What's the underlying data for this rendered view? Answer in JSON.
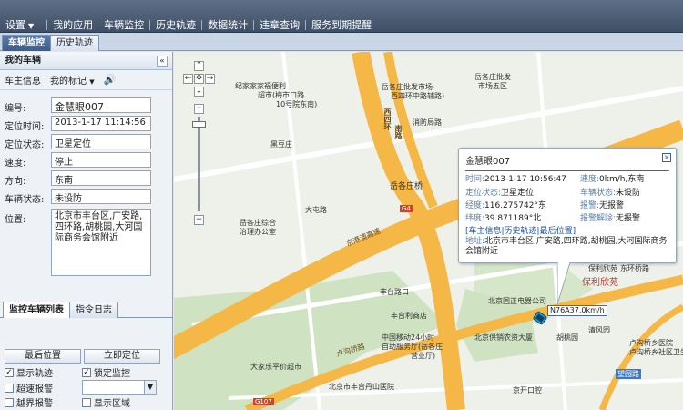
{
  "menu": {
    "settings": "设置",
    "items": [
      "我的应用",
      "车辆监控",
      "历史轨迹",
      "数据统计",
      "违章查询",
      "服务到期提醒"
    ]
  },
  "tabs": {
    "active": "车辆监控",
    "inactive": "历史轨迹"
  },
  "left": {
    "header": "我的车辆",
    "owner_info": "车主信息",
    "my_marks": "我的标记",
    "fields": {
      "id_label": "编号:",
      "id_value": "金慧眼007",
      "time_label": "定位时间:",
      "time_value": "2013-1-17 11:14:56",
      "status_label": "定位状态:",
      "status_value": "卫星定位",
      "speed_label": "速度:",
      "speed_value": "停止",
      "dir_label": "方向:",
      "dir_value": "东南",
      "vstatus_label": "车辆状态:",
      "vstatus_value": "未设防",
      "addr_label": "位置:",
      "addr_value": "北京市丰台区,广安路,四环路,胡桃园,大河国际商务会馆附近"
    },
    "bottom_tabs": {
      "a": "监控车辆列表",
      "b": "指令日志"
    },
    "btn_last_pos": "最后位置",
    "btn_locate": "立即定位",
    "checks": {
      "show_track": "显示轨迹",
      "lock_monitor": "锁定监控",
      "overspeed": "超速报警",
      "boundary": "越界报警",
      "show_area": "显示区域"
    }
  },
  "map": {
    "labels": {
      "l1": "纪家家家福便利",
      "l2": "超市(梅市口路",
      "l3": "10号院东南)",
      "l4": "岳各庄批发市场-",
      "l5": "西四环中路辅路)",
      "l6": "西四环",
      "l7": "南路",
      "l8": "岳各庄桥",
      "l9": "京港澳高速",
      "l10": "大屯路",
      "l11": "岳各庄综合",
      "l12": "治理办公室",
      "l13": "丰台路口",
      "l14": "丰台利商店",
      "l15": "中国移动24小时",
      "l16": "自助服务厅(岳各庄",
      "l17": "营业厅)",
      "l18": "大家乐平价超市",
      "l19": "北京市丰台丹山医院",
      "l20": "卢沟桥路",
      "l21": "保利欣苑",
      "l22": "北京国正电器公司",
      "l23": "胡桃园",
      "l24": "北京供销农资大厦",
      "l25": "卢沟桥乡医院",
      "l26": "望园路",
      "l27": "京开口腔",
      "l28": "东环桥路",
      "l29": "清风园",
      "l30": "卢沟桥乡社区卫生服务中心",
      "l31": "保利欣苑",
      "l32": "G4",
      "l33": "G107",
      "l34": "岳各庄批发",
      "l35": "市场五区",
      "l36": "消防局路",
      "l37": "黑豆庄"
    }
  },
  "popup": {
    "title": "金慧眼007",
    "time_label": "时间:",
    "time_value": "2013-1-17 10:56:47",
    "speed_label": "速度:",
    "speed_value": "0km/h,东南",
    "status_label": "定位状态:",
    "status_value": "卫星定位",
    "vstatus_label": "车辆状态:",
    "vstatus_value": "未设防",
    "lng_label": "经度:",
    "lng_value": "116.275742°东",
    "alarm_label": "报警:",
    "alarm_value": "无报警",
    "lat_label": "纬度:",
    "lat_value": "39.871189°北",
    "alarm_clear_label": "报警解除:",
    "alarm_clear_value": "无报警",
    "links": "[车主信息|历史轨迹|最后位置]",
    "addr_label": "地址:",
    "addr_value": "北京市丰台区,广安路,四环路,胡桃园,大河国际商务会馆附近"
  },
  "car_tag": "N76A37,0km/h",
  "colors": {
    "road_major": "#f5b746",
    "road_minor": "#ffffff",
    "accent": "#3d5e8c"
  }
}
